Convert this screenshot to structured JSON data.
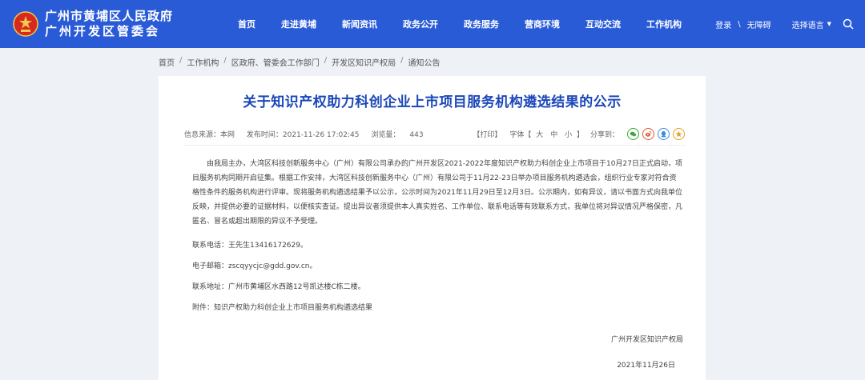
{
  "header": {
    "logo_line1": "广州市黄埔区人民政府",
    "logo_line2": "广州开发区管委会",
    "nav": [
      "首页",
      "走进黄埔",
      "新闻资讯",
      "政务公开",
      "政务服务",
      "营商环境",
      "互动交流",
      "工作机构"
    ],
    "login": "登录",
    "separator": "\\",
    "accessibility": "无障碍",
    "language": "选择语言"
  },
  "breadcrumb": [
    "首页",
    "工作机构",
    "区政府、管委会工作部门",
    "开发区知识产权局",
    "通知公告"
  ],
  "article": {
    "title": "关于知识产权助力科创企业上市项目服务机构遴选结果的公示",
    "source": "信息来源：本网",
    "published": "发布时间：2021-11-26 17:02:45",
    "views_label": "浏览量：",
    "views": "443",
    "print": "【打印】",
    "font_label": "字体【",
    "font_large": "大",
    "font_medium": "中",
    "font_small": "小",
    "font_end": "】",
    "share_label": "分享到：",
    "paragraph": "由我局主办，大湾区科技创新服务中心（广州）有限公司承办的广州开发区2021-2022年度知识产权助力科创企业上市项目于10月27日正式启动，项目服务机构同期开启征集。根据工作安排，大湾区科技创新服务中心（广州）有限公司于11月22-23日举办项目服务机构遴选会，组织行业专家对符合资格性条件的服务机构进行评审。现将服务机构遴选结果予以公示，公示时间为2021年11月29日至12月3日。公示期内，如有异议，请以书面方式向我单位反映，并提供必要的证据材料，以便核实查证。提出异议者须提供本人真实姓名、工作单位、联系电话等有效联系方式，我单位将对异议情况严格保密，凡匿名、冒名或超出期限的异议不予受理。",
    "phone": "联系电话：王先生13416172629。",
    "email": "电子邮箱：zscqyycjc@gdd.gov.cn。",
    "address": "联系地址：广州市黄埔区水西路12号凯达楼C栋二楼。",
    "attachment": "附件：知识产权助力科创企业上市项目服务机构遴选结果",
    "org": "广州开发区知识产权局",
    "date": "2021年11月26日"
  },
  "colors": {
    "header_bg": "#2a5bd7",
    "title": "#1a47b8",
    "page_bg": "#eef1f6"
  }
}
